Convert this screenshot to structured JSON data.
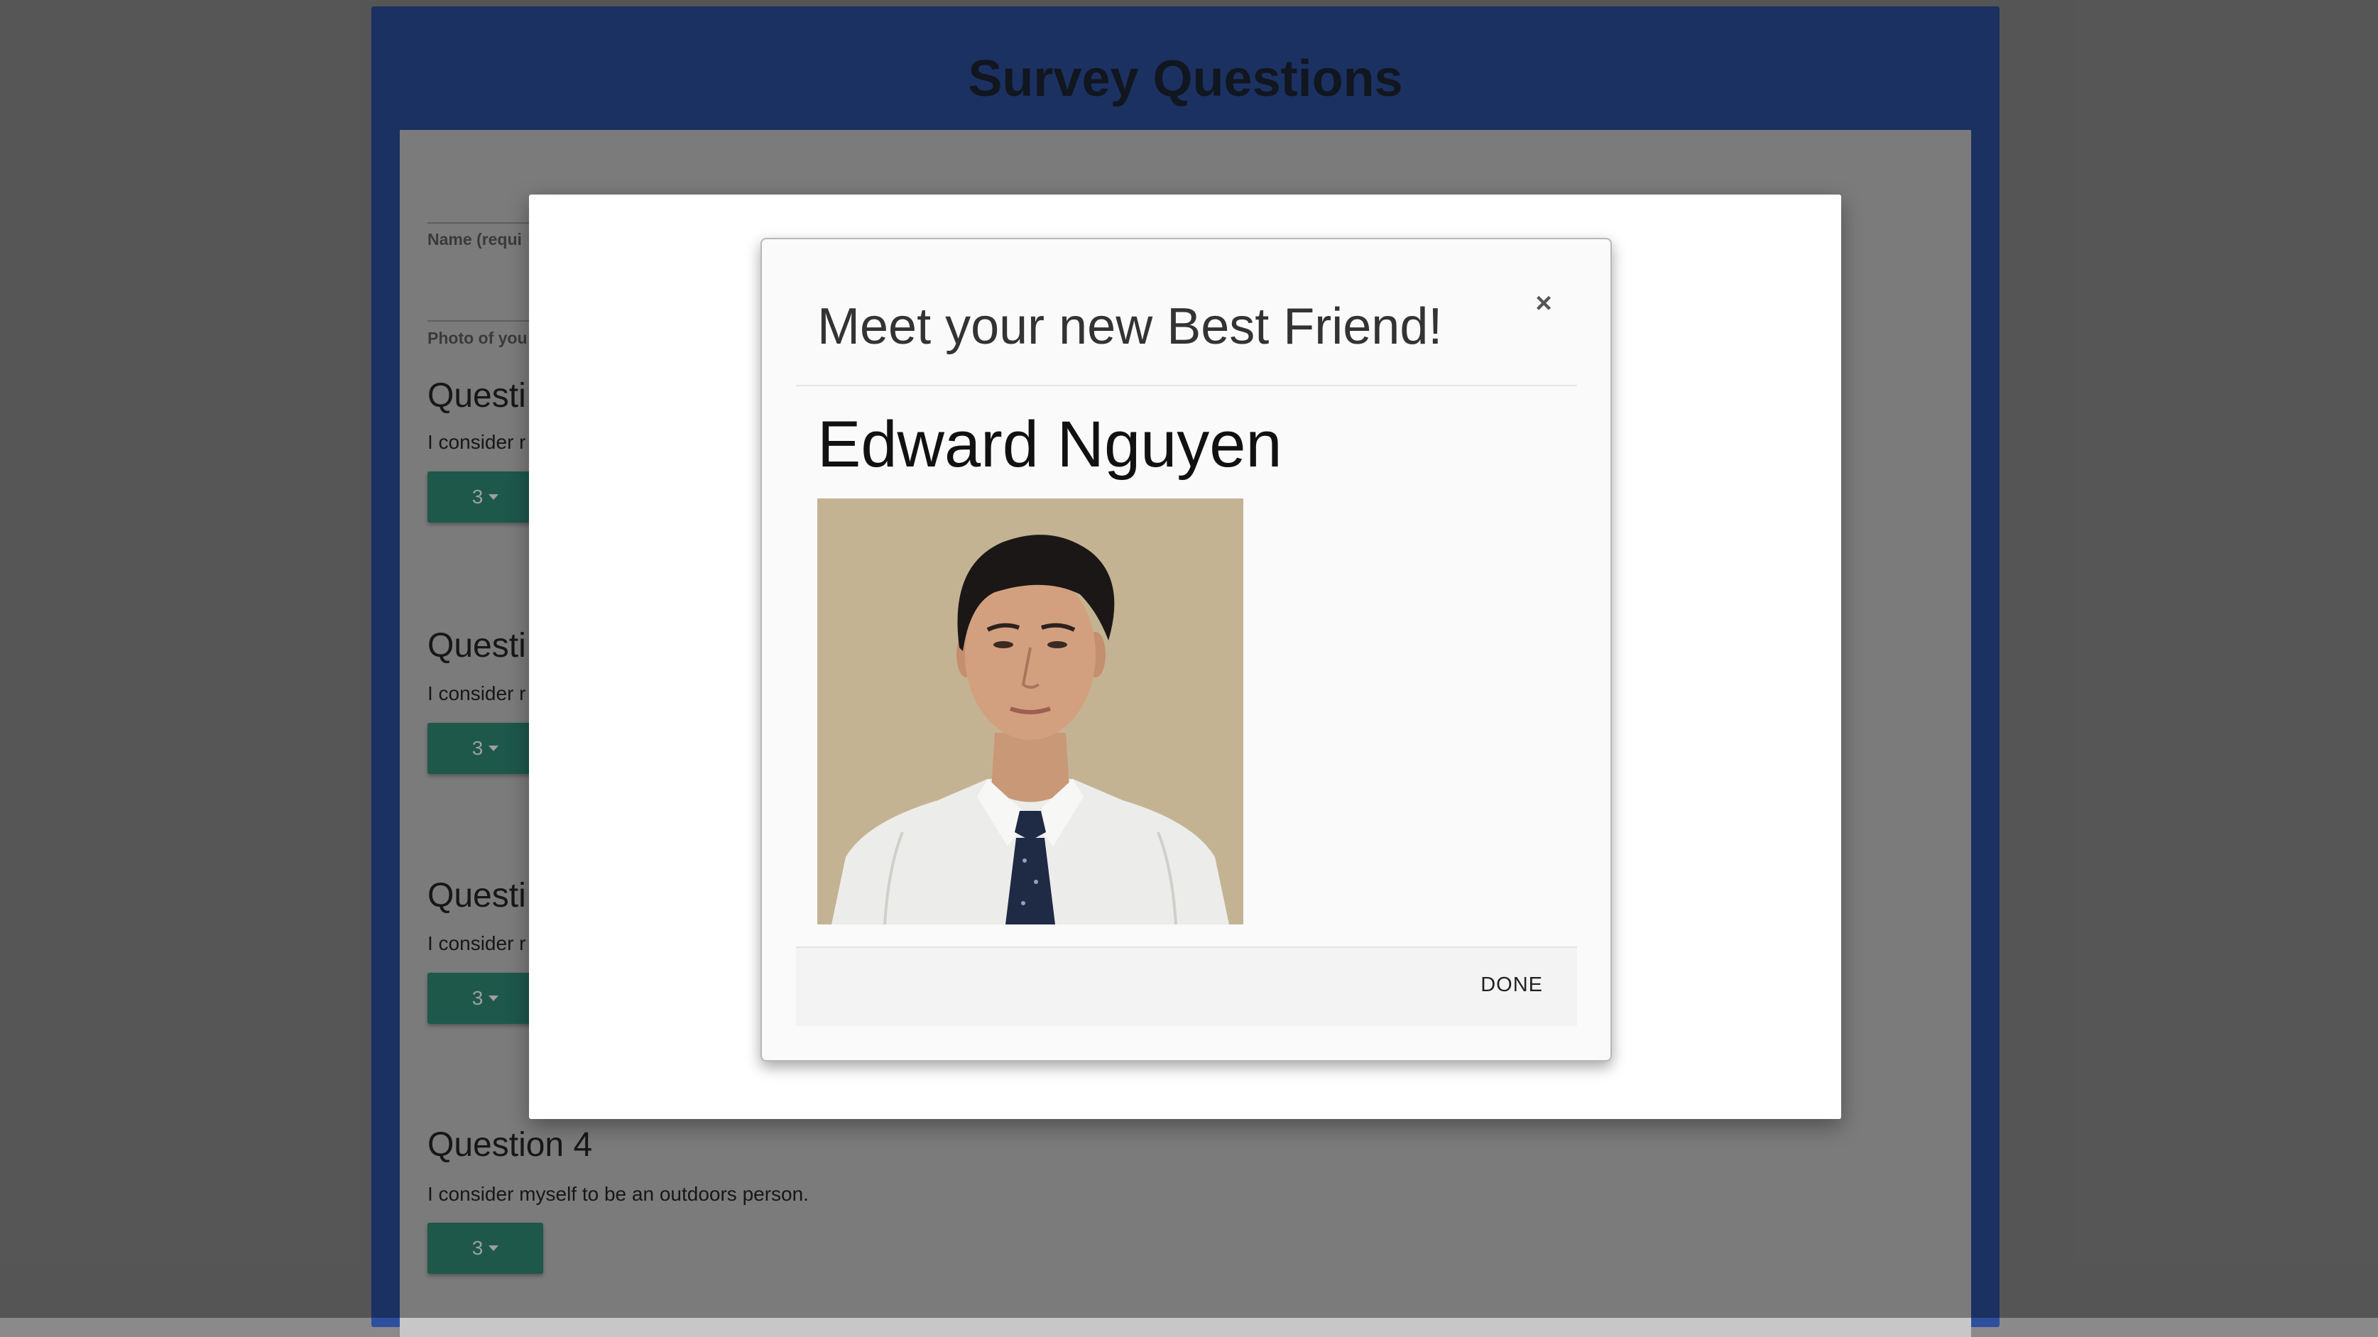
{
  "page": {
    "title": "Survey Questions"
  },
  "form": {
    "name_label": "Name (requi",
    "photo_label": "Photo of you",
    "questions": [
      {
        "title": "Questi",
        "text": "I consider r",
        "value": "3"
      },
      {
        "title": "Questi",
        "text": "I consider r",
        "value": "3"
      },
      {
        "title": "Questi",
        "text": "I consider r",
        "value": "3"
      },
      {
        "title": "Question 4",
        "text": "I consider myself to be an outdoors person.",
        "value": "3"
      }
    ]
  },
  "modal": {
    "title": "Meet your new Best Friend!",
    "close_symbol": "×",
    "friend_name": "Edward Nguyen",
    "done_label": "DONE"
  },
  "colors": {
    "header_blue": "#2d4f9e",
    "dropdown_teal": "#2f8f7a"
  }
}
